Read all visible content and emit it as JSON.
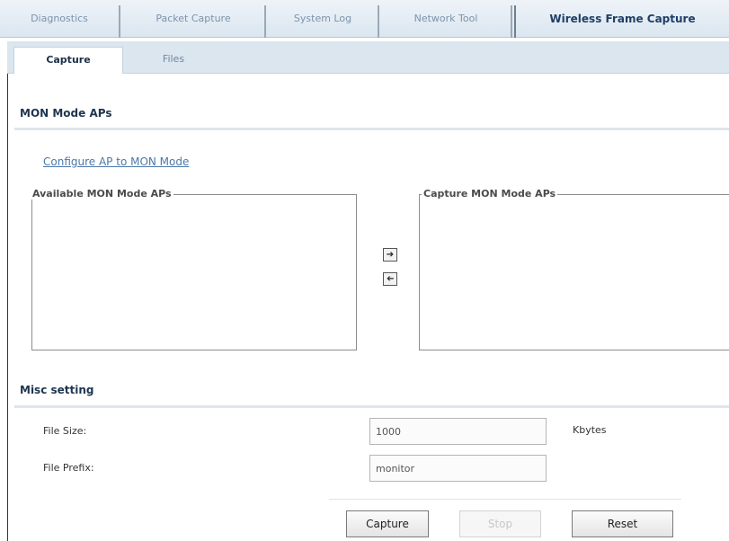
{
  "top_tabs": [
    {
      "label": "Diagnostics"
    },
    {
      "label": "Packet Capture"
    },
    {
      "label": "System Log"
    },
    {
      "label": "Network Tool"
    },
    {
      "label": "Wireless Frame Capture",
      "active": true
    }
  ],
  "sub_tabs": [
    {
      "label": "Capture",
      "active": true
    },
    {
      "label": "Files"
    }
  ],
  "mon_section": {
    "title": "MON Mode APs",
    "configure_link": "Configure AP to MON Mode",
    "available_legend": "Available MON Mode APs",
    "capture_legend": "Capture MON Mode APs",
    "add_icon": "arrow-right-icon",
    "remove_icon": "arrow-left-icon"
  },
  "misc_section": {
    "title": "Misc setting",
    "file_size_label": "File Size:",
    "file_size_value": "1000",
    "file_size_unit": "Kbytes",
    "file_prefix_label": "File Prefix:",
    "file_prefix_value": "monitor"
  },
  "actions": {
    "capture": "Capture",
    "stop": "Stop",
    "reset": "Reset"
  }
}
